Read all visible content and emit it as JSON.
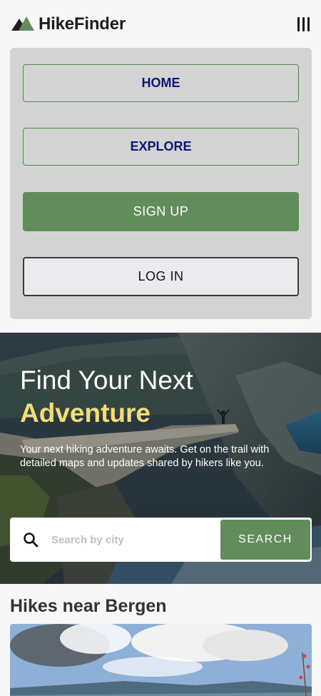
{
  "header": {
    "brand": "HikeFinder",
    "logo_icon": "mountain-icon",
    "menu_icon": "hamburger-menu-icon"
  },
  "nav": {
    "items": [
      {
        "label": "HOME"
      },
      {
        "label": "EXPLORE"
      },
      {
        "label": "SIGN UP"
      },
      {
        "label": "LOG IN"
      }
    ]
  },
  "hero": {
    "title_line1": "Find Your Next",
    "title_line2": "Adventure",
    "subtitle": "Your next hiking adventure awaits. Get on the trail with detailed maps and updates shared by hikers like you."
  },
  "search": {
    "placeholder": "Search by city",
    "value": "",
    "button_label": "SEARCH",
    "icon": "search-icon"
  },
  "section": {
    "title": "Hikes near Bergen"
  },
  "colors": {
    "brand_green": "#638c5c",
    "nav_text": "#0c1878",
    "accent_yellow": "#f3dd7a",
    "panel_bg": "#d3d3d3"
  }
}
